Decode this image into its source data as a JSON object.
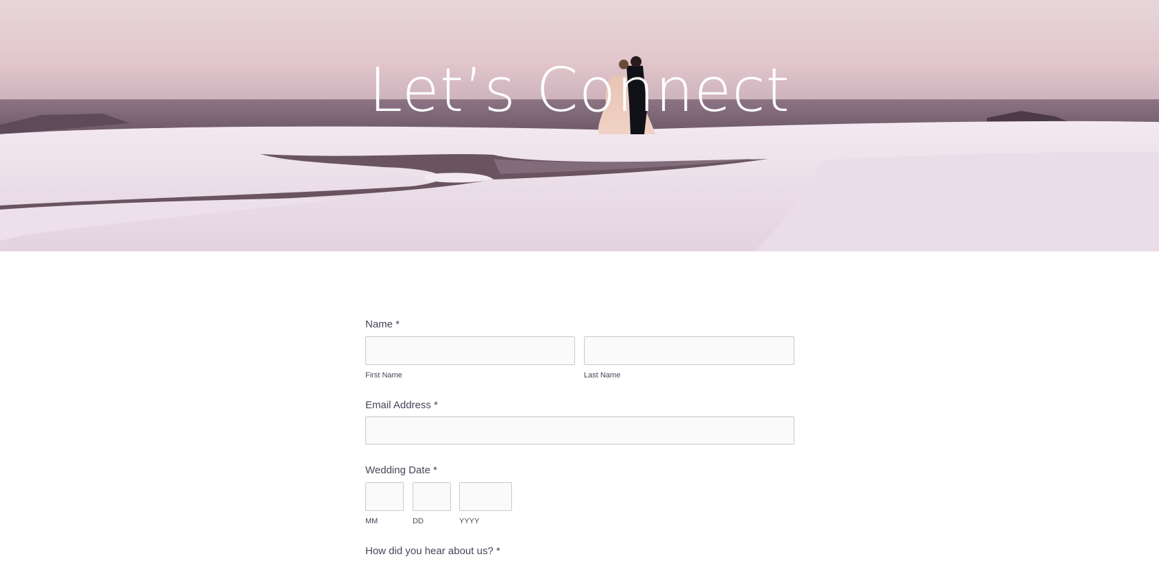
{
  "hero": {
    "title": "Let’s Connect"
  },
  "form": {
    "name": {
      "label": "Name *",
      "first_sublabel": "First Name",
      "last_sublabel": "Last Name",
      "first_value": "",
      "last_value": ""
    },
    "email": {
      "label": "Email Address *",
      "value": ""
    },
    "wedding_date": {
      "label": "Wedding Date *",
      "mm_sublabel": "MM",
      "dd_sublabel": "DD",
      "yyyy_sublabel": "YYYY"
    },
    "referral": {
      "label": "How did you hear about us? *"
    }
  },
  "colors": {
    "text": "#4a4258",
    "input_bg": "#fafafa",
    "input_border": "#c9c9c9"
  }
}
